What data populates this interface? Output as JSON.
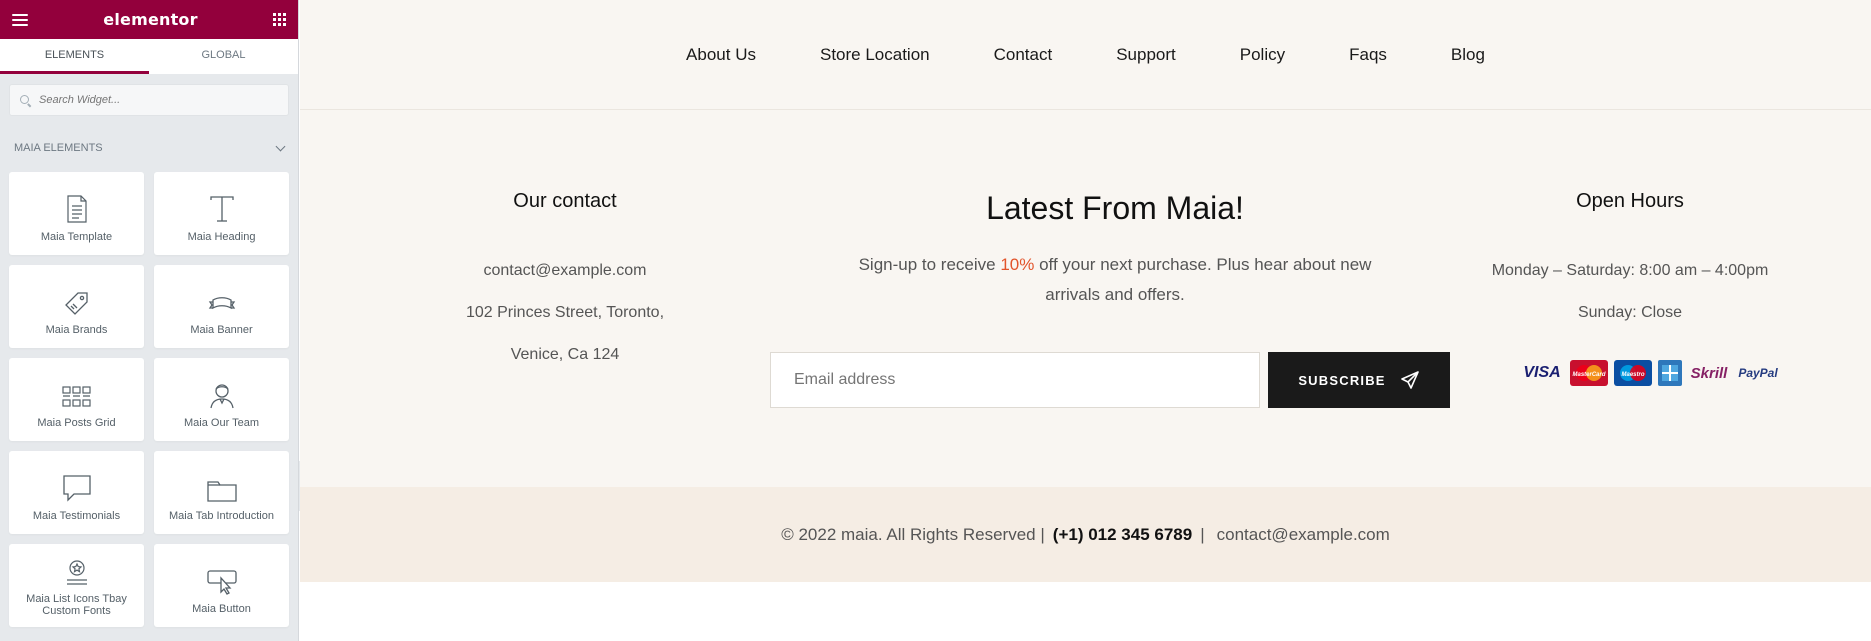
{
  "panel": {
    "brand": "elementor",
    "tabs": [
      "ELEMENTS",
      "GLOBAL"
    ],
    "search_placeholder": "Search Widget...",
    "category": "MAIA ELEMENTS",
    "widgets": [
      {
        "label": "Maia Template",
        "icon": "document-icon"
      },
      {
        "label": "Maia Heading",
        "icon": "heading-t-icon"
      },
      {
        "label": "Maia Brands",
        "icon": "tag-icon"
      },
      {
        "label": "Maia Banner",
        "icon": "banner-icon"
      },
      {
        "label": "Maia Posts Grid",
        "icon": "posts-grid-icon"
      },
      {
        "label": "Maia Our Team",
        "icon": "team-member-icon"
      },
      {
        "label": "Maia Testimonials",
        "icon": "speech-bubble-icon"
      },
      {
        "label": "Maia Tab Introduction",
        "icon": "tab-icon"
      },
      {
        "label": "Maia List Icons Tbay Custom Fonts",
        "icon": "star-list-icon"
      },
      {
        "label": "Maia Button",
        "icon": "button-cursor-icon"
      }
    ]
  },
  "nav": {
    "items": [
      "About Us",
      "Store Location",
      "Contact",
      "Support",
      "Policy",
      "Faqs",
      "Blog"
    ]
  },
  "contact": {
    "title": "Our contact",
    "email": "contact@example.com",
    "address_line1": "102 Princes Street, Toronto,",
    "address_line2": "Venice, Ca 124"
  },
  "newsletter": {
    "title": "Latest From Maia!",
    "desc_before": "Sign-up to receive ",
    "desc_highlight": "10%",
    "desc_after": " off your next purchase. Plus hear about new arrivals and offers.",
    "email_placeholder": "Email address",
    "button_label": "SUBSCRIBE"
  },
  "hours": {
    "title": "Open Hours",
    "weekdays": "Monday – Saturday: 8:00 am – 4:00pm",
    "sunday": "Sunday: Close"
  },
  "payments": [
    "VISA",
    "MasterCard",
    "Maestro",
    "American Express",
    "Skrill",
    "PayPal"
  ],
  "copyright": {
    "text": "© 2022 maia. All Rights Reserved |",
    "phone": "(+1) 012 345 6789",
    "separator": "|",
    "email": "contact@example.com"
  },
  "colors": {
    "brand": "#93003c",
    "accent": "#e2542b",
    "footer_bg": "#f9f6f2",
    "copyright_bg": "#f5ede4"
  }
}
